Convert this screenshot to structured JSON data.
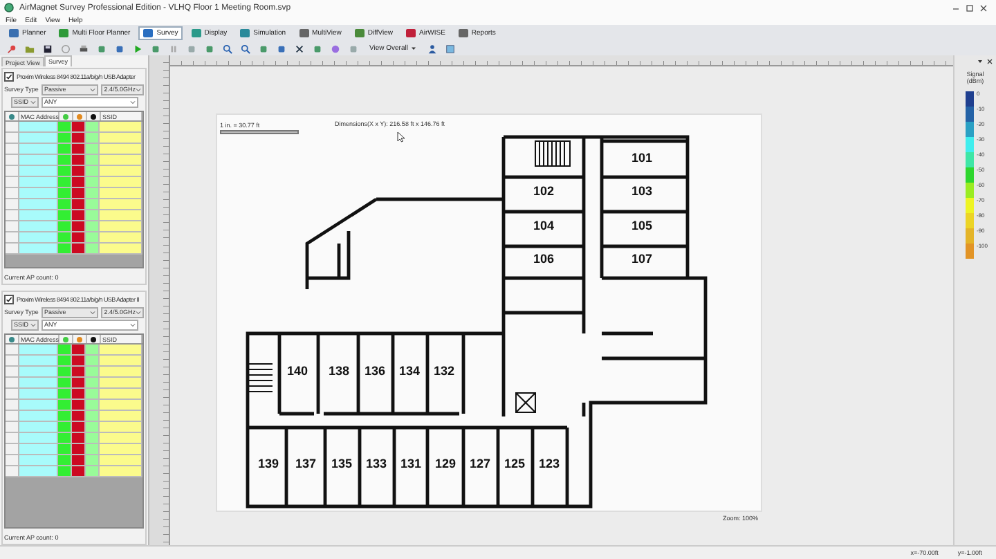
{
  "window": {
    "title": "AirMagnet Survey Professional Edition - VLHQ Floor 1 Meeting Room.svp"
  },
  "menu": [
    "File",
    "Edit",
    "View",
    "Help"
  ],
  "mode_tabs": [
    {
      "label": "Planner",
      "selected": false
    },
    {
      "label": "Multi Floor Planner",
      "selected": false
    },
    {
      "label": "Survey",
      "selected": true
    },
    {
      "label": "Display",
      "selected": false
    },
    {
      "label": "Simulation",
      "selected": false
    },
    {
      "label": "MultiView",
      "selected": false
    },
    {
      "label": "DiffView",
      "selected": false
    },
    {
      "label": "AirWISE",
      "selected": false
    },
    {
      "label": "Reports",
      "selected": false
    }
  ],
  "toolbar": {
    "view_dropdown": "View Overall"
  },
  "side_tabs": [
    {
      "label": "Project View",
      "selected": false
    },
    {
      "label": "Survey",
      "selected": true
    }
  ],
  "adapters": [
    {
      "name": "Proxim Wireless 8494 802.11a/b/g/n USB Adapter",
      "checked": true,
      "survey_type_label": "Survey Type",
      "survey_type": "Passive",
      "band": "2.4/5.0GHz",
      "filter_field": "SSID",
      "filter_value": "ANY",
      "ap_count": "Current AP count: 0",
      "columns": [
        {
          "kind": "icon",
          "color": "#f2f2f2"
        },
        {
          "kind": "text",
          "label": "MAC Address",
          "color": "#a8fbfb"
        },
        {
          "kind": "icon",
          "color": "#33ee33"
        },
        {
          "kind": "icon",
          "color": "#cc0a22"
        },
        {
          "kind": "icon",
          "color": "#99fb99"
        },
        {
          "kind": "text",
          "label": "SSID",
          "color": "#fbfb8c"
        }
      ]
    },
    {
      "name": "Proxim Wireless 8494 802.11a/b/g/n USB Adapter II",
      "checked": true,
      "survey_type_label": "Survey Type",
      "survey_type": "Passive",
      "band": "2.4/5.0GHz",
      "filter_field": "SSID",
      "filter_value": "ANY",
      "ap_count": "Current AP count: 0",
      "columns": [
        {
          "kind": "icon",
          "color": "#f2f2f2"
        },
        {
          "kind": "text",
          "label": "MAC Address",
          "color": "#a8fbfb"
        },
        {
          "kind": "icon",
          "color": "#33ee33"
        },
        {
          "kind": "icon",
          "color": "#cc0a22"
        },
        {
          "kind": "icon",
          "color": "#99fb99"
        },
        {
          "kind": "text",
          "label": "SSID",
          "color": "#fbfb8c"
        }
      ]
    }
  ],
  "floor_plan": {
    "scale": "1 in. = 30.77 ft",
    "dimensions": "Dimensions(X x Y): 216.58 ft x 146.76 ft",
    "zoom": "Zoom: 100%",
    "rooms": [
      "101",
      "102",
      "103",
      "104",
      "105",
      "106",
      "107",
      "140",
      "138",
      "136",
      "134",
      "132",
      "139",
      "137",
      "135",
      "133",
      "131",
      "129",
      "127",
      "125",
      "123"
    ]
  },
  "legend": {
    "title": "Signal (dBm)",
    "items": [
      {
        "label": "0",
        "color": "#1f3f8f"
      },
      {
        "label": "-10",
        "color": "#2462a6"
      },
      {
        "label": "-20",
        "color": "#2aa0c4"
      },
      {
        "label": "-30",
        "color": "#40eeee"
      },
      {
        "label": "-40",
        "color": "#3ee6a6"
      },
      {
        "label": "-50",
        "color": "#2ed62e"
      },
      {
        "label": "-60",
        "color": "#9aec22"
      },
      {
        "label": "-70",
        "color": "#eef424"
      },
      {
        "label": "-80",
        "color": "#ecd426"
      },
      {
        "label": "-90",
        "color": "#e4b428"
      },
      {
        "label": "-100",
        "color": "#e29426"
      }
    ]
  },
  "status_bar": {
    "x": "x=-70.00ft",
    "y": "y=-1.00ft"
  }
}
